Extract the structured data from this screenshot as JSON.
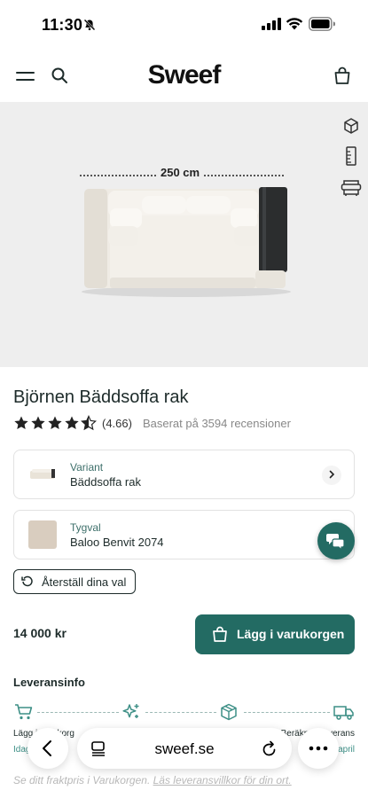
{
  "status_bar": {
    "time": "11:30"
  },
  "header": {
    "logo": "Sweef"
  },
  "product_image": {
    "width_label": "250 cm"
  },
  "product": {
    "title": "Björnen Bäddsoffa rak",
    "rating": 4.66,
    "rating_text": "(4.66)",
    "review_text": "Baserat på 3594 recensioner"
  },
  "options": {
    "variant": {
      "label": "Variant",
      "value": "Bäddsoffa rak"
    },
    "fabric": {
      "label": "Tygval",
      "value": "Baloo Benvit 2074"
    }
  },
  "reset": {
    "label": "Återställ dina val"
  },
  "purchase": {
    "price": "14 000 kr",
    "button_label": "Lägg i varukorgen"
  },
  "delivery": {
    "heading": "Leveransinfo",
    "steps": [
      {
        "label": "Lägg i varukorg",
        "sub": "Idag"
      },
      {
        "label": "",
        "sub": ""
      },
      {
        "label": "",
        "sub": ""
      },
      {
        "label": "Beräknad leverans",
        "sub": "april"
      }
    ],
    "footnote_text": "Se ditt fraktpris i Varukorgen. ",
    "footnote_link": "Läs leveransvillkor för din ort."
  },
  "browser": {
    "url": "sweef.se"
  },
  "colors": {
    "brand": "#236b63",
    "text": "#1d2b2a",
    "image_bg": "#eeeeee"
  }
}
